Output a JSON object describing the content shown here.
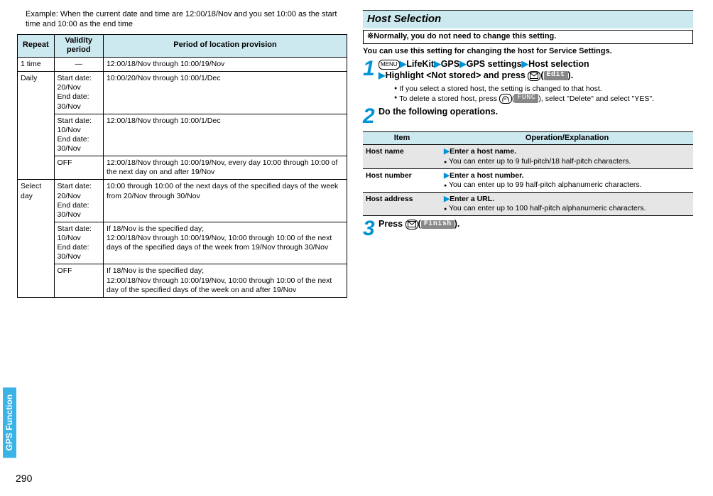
{
  "left": {
    "example": "Example: When the current date and time are 12:00/18/Nov and you set 10:00 as the start time and 10:00 as the end time",
    "headers": [
      "Repeat",
      "Validity period",
      "Period of location provision"
    ],
    "rows": [
      {
        "repeat": "1 time",
        "validity": "—",
        "period": "12:00/18/Nov through 10:00/19/Nov"
      },
      {
        "repeat": "Daily",
        "validity": "Start date: 20/Nov\nEnd date: 30/Nov",
        "period": "10:00/20/Nov through 10:00/1/Dec"
      },
      {
        "repeat": "",
        "validity": "Start date: 10/Nov\nEnd date: 30/Nov",
        "period": "12:00/18/Nov through 10:00/1/Dec"
      },
      {
        "repeat": "",
        "validity": "OFF",
        "period": "12:00/18/Nov through 10:00/19/Nov, every day 10:00 through 10:00 of the next day on and after 19/Nov"
      },
      {
        "repeat": "Select day",
        "validity": "Start date: 20/Nov\nEnd date: 30/Nov",
        "period": "10:00 through 10:00 of the next days of the specified days of the week from 20/Nov through 30/Nov"
      },
      {
        "repeat": "",
        "validity": "Start date: 10/Nov\nEnd date: 30/Nov",
        "period": "If 18/Nov is the specified day;\n12:00/18/Nov through 10:00/19/Nov, 10:00 through 10:00 of the next days of the specified days of the week from 19/Nov through 30/Nov"
      },
      {
        "repeat": "",
        "validity": "OFF",
        "period": "If 18/Nov is the specified day;\n12:00/18/Nov through 10:00/19/Nov, 10:00 through 10:00 of the next day of the specified days of the week on and after 19/Nov"
      }
    ]
  },
  "right": {
    "heading": "Host Selection",
    "note": "※Normally, you do not need to change this setting.",
    "intro": "You can use this setting for changing the host for Service Settings.",
    "step1": {
      "chain": [
        "LifeKit",
        "GPS",
        "GPS settings",
        "Host selection"
      ],
      "line2_prefix": "Highlight <Not stored> and press ",
      "pill": "Edit",
      "bullets": [
        "If you select a stored host, the setting is changed to that host.",
        "To delete a stored host, press |IRKEY|(|FUNC|), select \"Delete\" and select \"YES\"."
      ]
    },
    "step2": {
      "text": "Do the following operations."
    },
    "ops": {
      "headers": [
        "Item",
        "Operation/Explanation"
      ],
      "rows": [
        {
          "item": "Host name",
          "op": "Enter a host name.",
          "note": "You can enter up to 9 full-pitch/18 half-pitch characters."
        },
        {
          "item": "Host number",
          "op": "Enter a host number.",
          "note": "You can enter up to 99 half-pitch alphanumeric characters."
        },
        {
          "item": "Host address",
          "op": "Enter a URL.",
          "note": "You can enter up to 100 half-pitch alphanumeric characters."
        }
      ]
    },
    "step3": {
      "prefix": "Press ",
      "pill": "Finish",
      "suffix": "."
    }
  },
  "side_tab": "GPS Function",
  "page_no": "290",
  "keys": {
    "menu": "MENU",
    "func": "FUNC"
  }
}
